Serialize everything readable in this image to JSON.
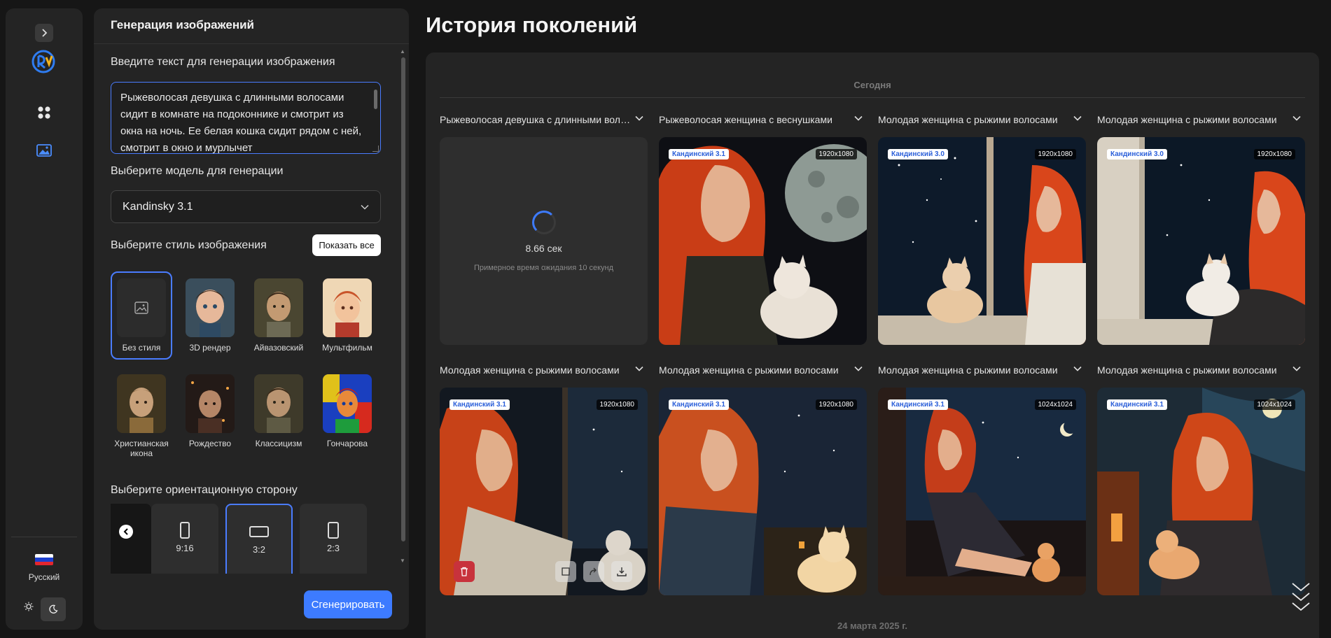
{
  "rail": {
    "language": "Русский",
    "flag_colors": [
      "#ffffff",
      "#1c3fcf",
      "#e3262e"
    ]
  },
  "panel": {
    "title": "Генерация изображений",
    "prompt_label": "Введите текст для генерации изображения",
    "prompt_value": "Рыжеволосая девушка с длинными волосами сидит в комнате на подоконнике и смотрит из окна на ночь. Ее белая кошка сидит рядом с ней, смотрит в окно и мурлычет",
    "model_label": "Выберите модель для генерации",
    "model_value": "Kandinsky 3.1",
    "style_label": "Выберите стиль изображения",
    "show_all": "Показать все",
    "styles": [
      {
        "name": "Без стиля",
        "selected": true
      },
      {
        "name": "3D рендер",
        "selected": false
      },
      {
        "name": "Айвазовский",
        "selected": false
      },
      {
        "name": "Мультфильм",
        "selected": false
      },
      {
        "name": "Христианская икона",
        "selected": false
      },
      {
        "name": "Рождество",
        "selected": false
      },
      {
        "name": "Классицизм",
        "selected": false
      },
      {
        "name": "Гончарова",
        "selected": false
      }
    ],
    "orientation_label": "Выберите ориентационную сторону",
    "orientations": [
      {
        "label": "9:16",
        "selected": false
      },
      {
        "label": "3:2",
        "selected": true
      },
      {
        "label": "2:3",
        "selected": false
      }
    ],
    "generate_button": "Сгенерировать"
  },
  "history": {
    "title": "История поколений",
    "today_label": "Сегодня",
    "loading": {
      "time": "8.66 сек",
      "note": "Примерное время ожидания 10 секунд"
    },
    "cards": [
      {
        "title": "Рыжеволосая девушка с длинными волосами сидит",
        "model": "",
        "resolution": "",
        "loading": true
      },
      {
        "title": "Рыжеволосая женщина с веснушками",
        "model": "Кандинский 3.1",
        "resolution": "1920x1080"
      },
      {
        "title": "Молодая женщина с рыжими волосами",
        "model": "Кандинский 3.0",
        "resolution": "1920x1080"
      },
      {
        "title": "Молодая женщина с рыжими волосами",
        "model": "Кандинский 3.0",
        "resolution": "1920x1080"
      },
      {
        "title": "Молодая женщина с рыжими волосами",
        "model": "Кандинский 3.1",
        "resolution": "1920x1080"
      },
      {
        "title": "Молодая женщина с рыжими волосами",
        "model": "Кандинский 3.1",
        "resolution": "1920x1080"
      },
      {
        "title": "Молодая женщина с рыжими волосами",
        "model": "Кандинский 3.1",
        "resolution": "1024x1024"
      },
      {
        "title": "Молодая женщина с рыжими волосами",
        "model": "Кандинский 3.1",
        "resolution": "1024x1024"
      }
    ],
    "date_label": "24 марта 2025 г."
  },
  "colors": {
    "accent": "#3d7bff",
    "delete": "#c8323c",
    "hair": "#d9481c"
  }
}
